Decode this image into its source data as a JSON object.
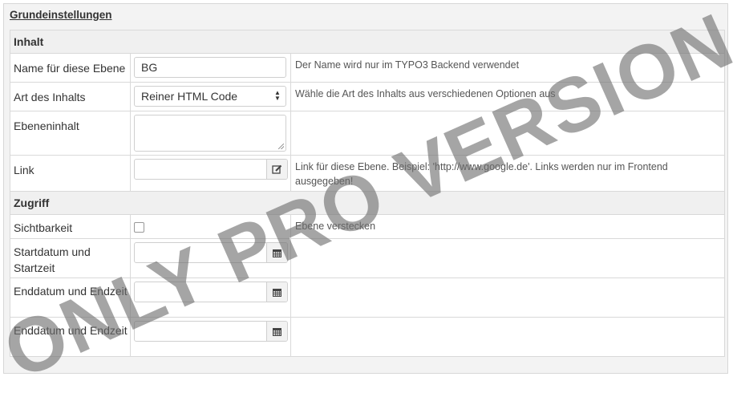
{
  "section_title": "Grundeinstellungen",
  "groups": {
    "inhalt": "Inhalt",
    "zugriff": "Zugriff"
  },
  "fields": {
    "name": {
      "label": "Name für diese Ebene",
      "value": "BG",
      "help": "Der Name wird nur im TYPO3 Backend verwendet"
    },
    "art": {
      "label": "Art des Inhalts",
      "selected": "Reiner HTML Code",
      "help": "Wähle die Art des Inhalts aus verschiedenen Optionen aus"
    },
    "ebeneninhalt": {
      "label": "Ebeneninhalt",
      "value": ""
    },
    "link": {
      "label": "Link",
      "value": "",
      "help": "Link für diese Ebene. Beispiel: 'http://www.google.de'. Links werden nur im Frontend ausgegeben!"
    },
    "sichtbarkeit": {
      "label": "Sichtbarkeit",
      "checked": false,
      "help": "Ebene verstecken"
    },
    "startdatum": {
      "label": "Startdatum und Startzeit",
      "value": ""
    },
    "enddatum1": {
      "label": "Enddatum und Endzeit",
      "value": ""
    },
    "enddatum2": {
      "label": "Enddatum und Endzeit",
      "value": ""
    }
  },
  "watermark": "ONLY PRO VERSION",
  "icons": {
    "link_addon": "edit-link-icon",
    "date_addon": "calendar-icon"
  }
}
